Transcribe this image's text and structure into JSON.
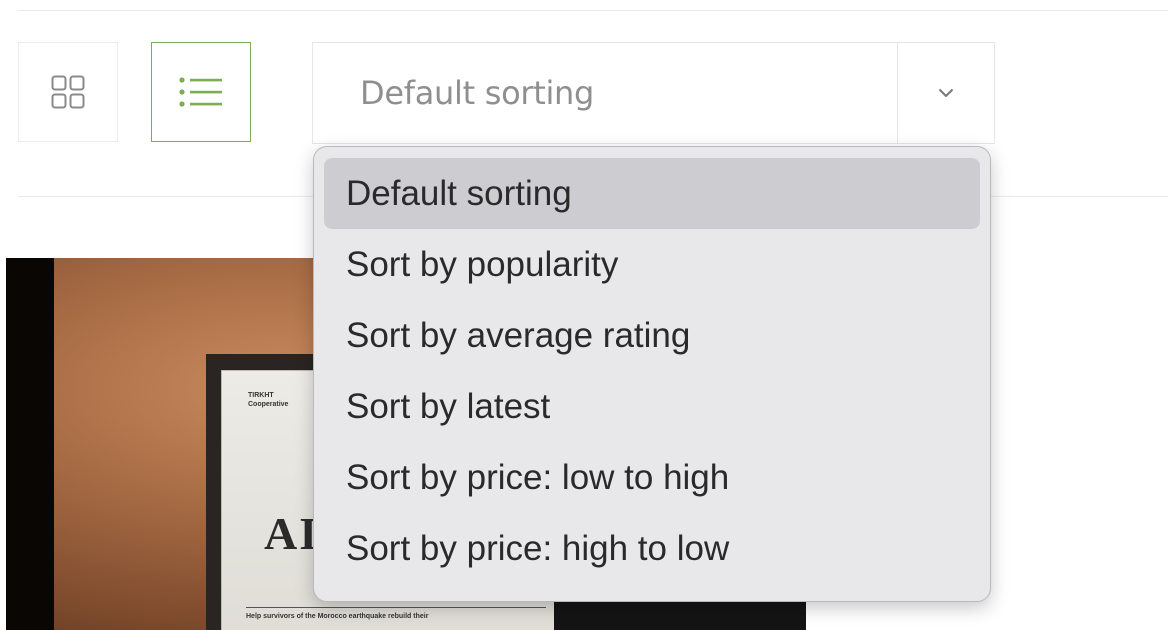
{
  "toolbar": {
    "view_grid_icon": "grid-icon",
    "view_list_icon": "list-icon",
    "accent_color": "#7cad52"
  },
  "sort": {
    "current_value": "Default sorting",
    "arrow_icon": "chevron-down-icon",
    "options": [
      {
        "label": "Default sorting",
        "selected": true
      },
      {
        "label": "Sort by popularity",
        "selected": false
      },
      {
        "label": "Sort by average rating",
        "selected": false
      },
      {
        "label": "Sort by latest",
        "selected": false
      },
      {
        "label": "Sort by price: low to high",
        "selected": false
      },
      {
        "label": "Sort by price: high to low",
        "selected": false
      }
    ]
  },
  "product": {
    "image_label_small": "TIRKHT\nCooperative",
    "image_label_big": "AI",
    "image_label_footer": "Help survivors of the Morocco earthquake rebuild their"
  }
}
